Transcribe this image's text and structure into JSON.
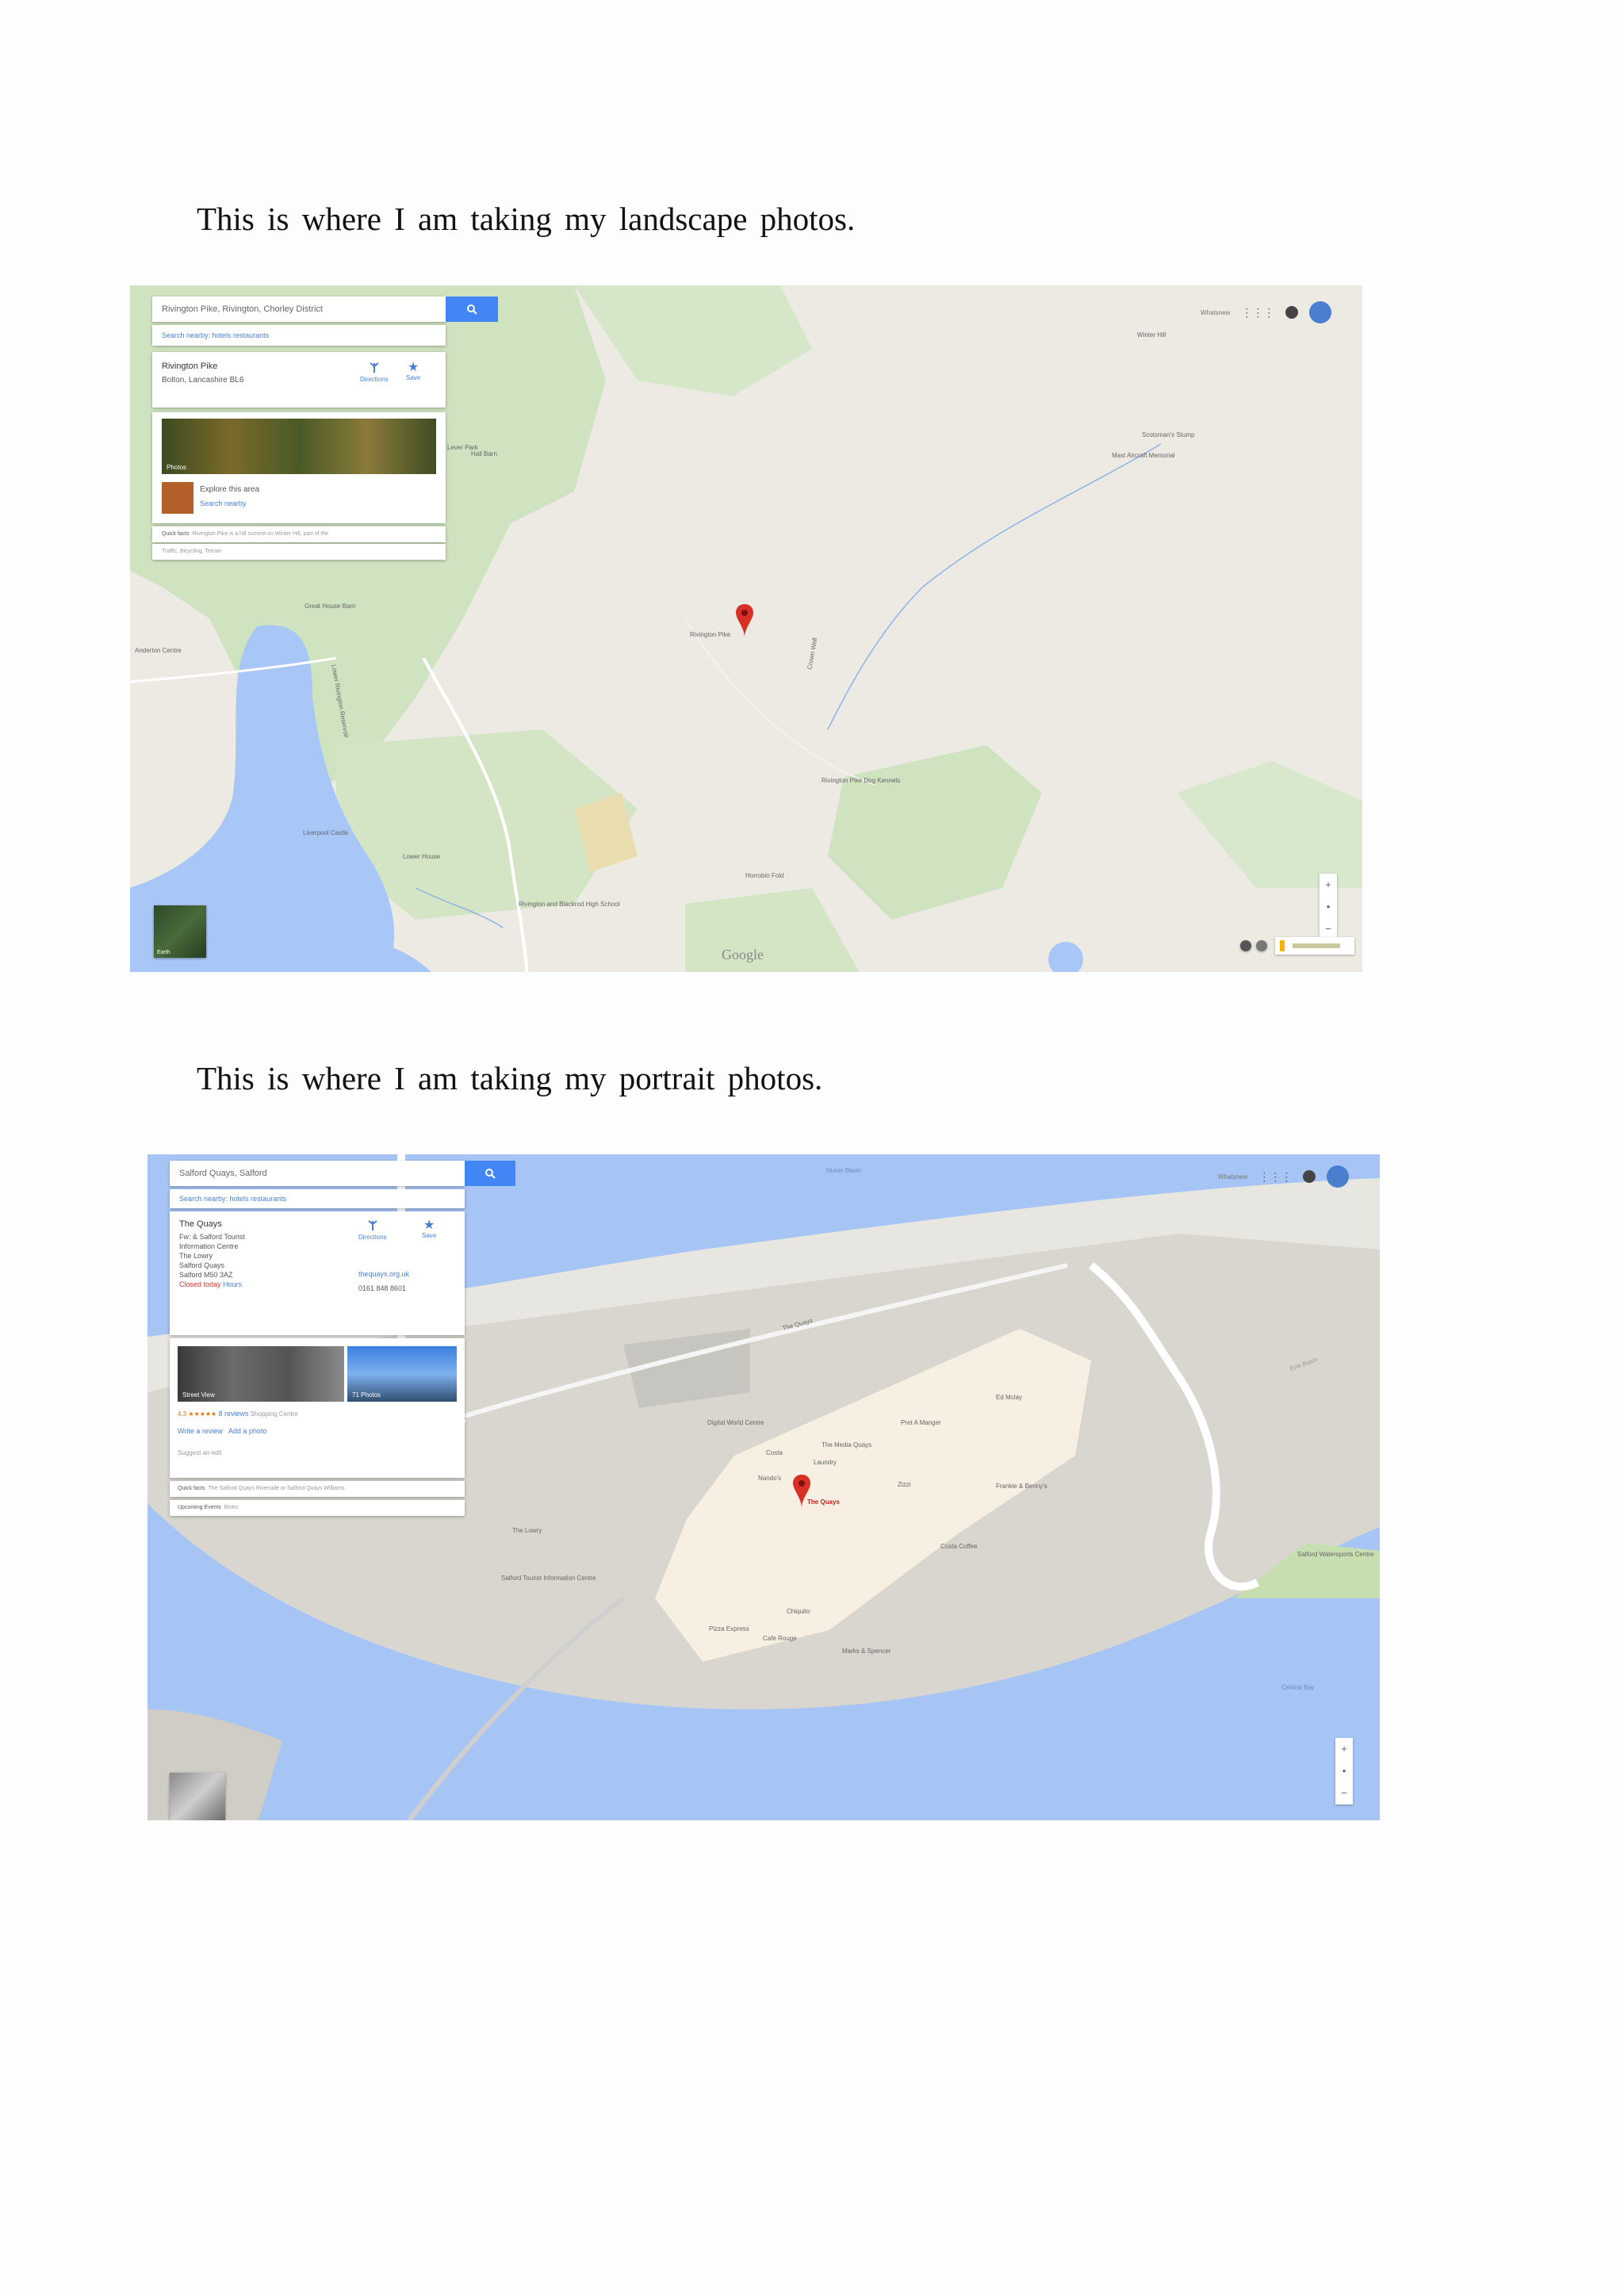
{
  "captions": {
    "landscape": "This is where I am taking my landscape photos.",
    "portrait": "This is where I am taking my portrait photos."
  },
  "map1": {
    "search_value": "Rivington Pike, Rivington, Chorley District",
    "nearby": "Search nearby: hotels restaurants",
    "place_name": "Rivington Pike",
    "place_address": "Bolton, Lancashire BL6",
    "directions": "Directions",
    "save": "Save",
    "photos_label": "Photos",
    "explore": "Explore this area",
    "search_nearby": "Search nearby",
    "quick_facts": "Quick facts",
    "quick_facts_text": "Rivington Pike is a hill summit on Winter Hill, part of the",
    "traffic": "Traffic, Bicycling, Terrain",
    "whatsnew": "Whatsnew",
    "pin_label": "Rivington Pike",
    "labels": [
      "Winter Hill",
      "Scotsman's Stump",
      "Mast Aircraft Memorial",
      "Rivington Pike Dog Kennels",
      "Great House Barn",
      "Lever Park",
      "Rivington and Blackrod High School",
      "Lower Rivington Reservoir",
      "Anderton Centre",
      "Liverpool Castle",
      "Lower House",
      "Horrobin Fold",
      "Crown Well",
      "Hall Barn",
      "Earth",
      "Google"
    ]
  },
  "map2": {
    "search_value": "Salford Quays, Salford",
    "nearby": "Search nearby: hotels restaurants",
    "place_name": "The Quays",
    "place_lines": [
      "Fw: & Salford Tourist",
      "Information Centre",
      "The Lowry",
      "Salford Quays",
      "Salford M50 3AZ"
    ],
    "status": "Closed today",
    "hours": "Hours",
    "directions": "Directions",
    "save": "Save",
    "website": "thequays.org.uk",
    "phone": "0161 848 8601",
    "street_view": "Street View",
    "photos_count": "71 Photos",
    "rating": "4.3",
    "reviews": "8 reviews",
    "category": "Shopping Centre",
    "write_review": "Write a review",
    "add_photo": "Add a photo",
    "suggest_edit": "Suggest an edit",
    "quick_facts": "Quick facts",
    "quick_facts_text": "The Salford Quays Riverside or Salford Quays Williams",
    "upcoming": "Upcoming Events",
    "upcoming_more": "Bistro",
    "whatsnew": "Whatsnew",
    "pin_label": "The Quays",
    "labels": [
      "The Lowry",
      "Salford Tourist Information Centre",
      "Digital World Centre",
      "Costa",
      "Pret A Manger",
      "The Media Quays",
      "Laundry",
      "Marks & Spencer",
      "Zizzi",
      "Nando's",
      "Frankie & Benny's",
      "Pizza Express",
      "Chiquito",
      "Costa Coffee",
      "Cafe Rouge",
      "Ed Mclay",
      "Central Bay",
      "The Quays",
      "Huron Basin",
      "Erie Basin",
      "Salford Watersports Centre"
    ]
  }
}
